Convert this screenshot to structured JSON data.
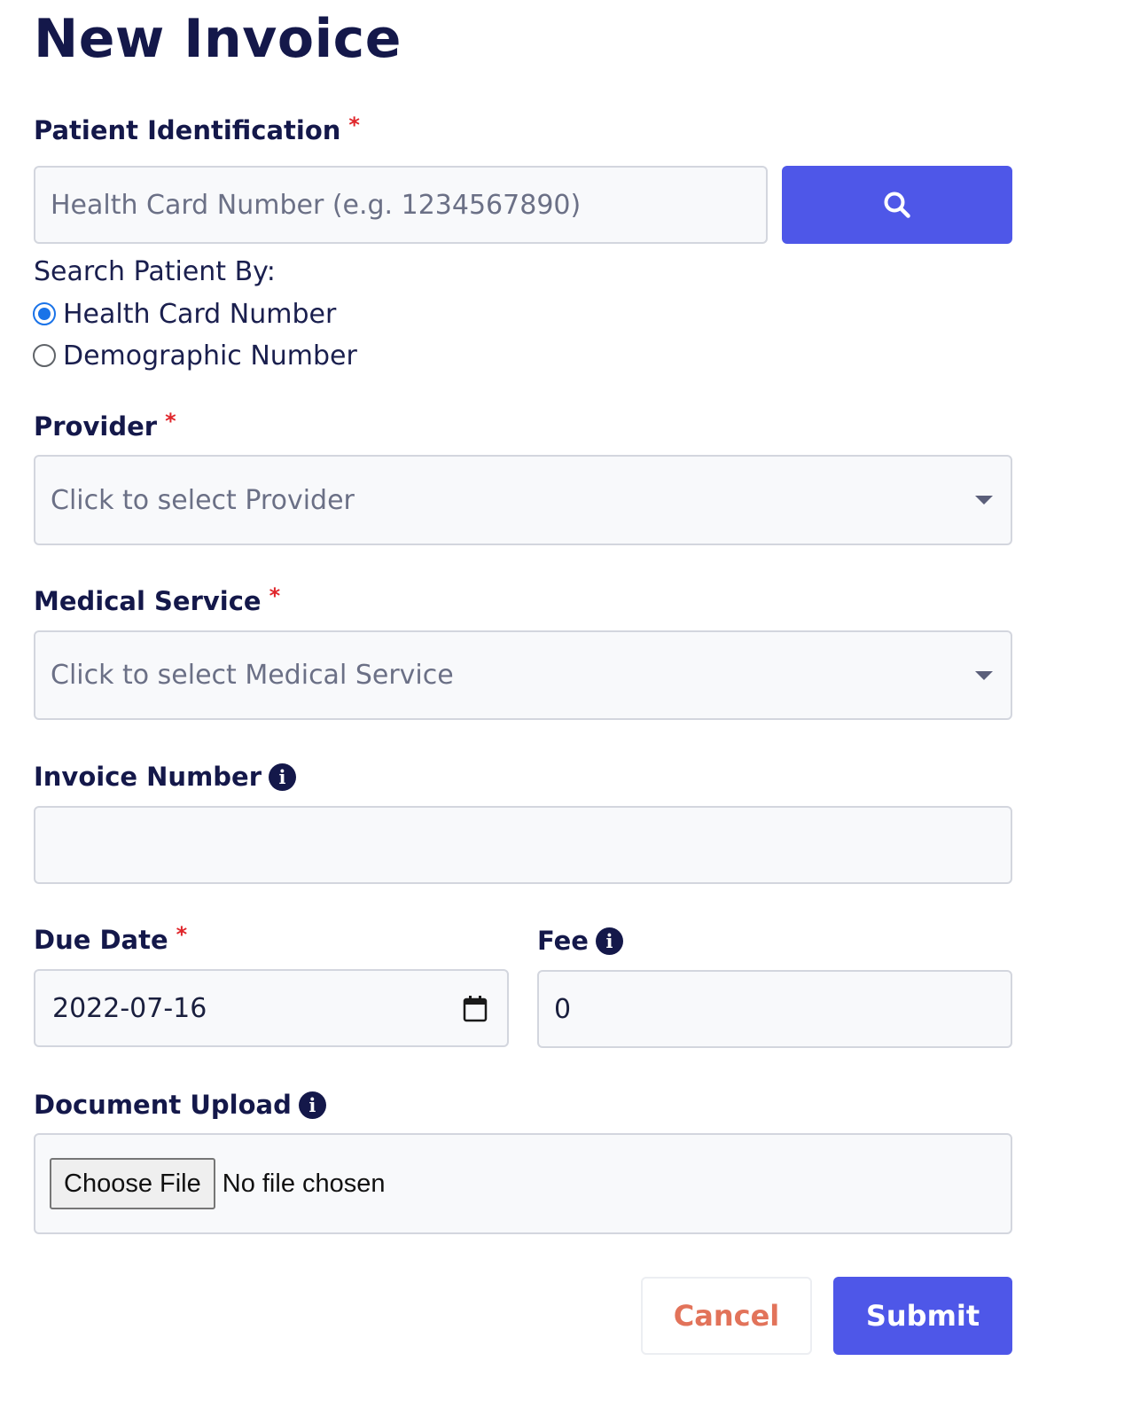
{
  "page": {
    "title": "New Invoice"
  },
  "patient": {
    "label": "Patient Identification",
    "required_mark": "*",
    "placeholder": "Health Card Number (e.g. 1234567890)",
    "value": "",
    "search_icon": "search-icon"
  },
  "search_by": {
    "label": "Search Patient By:",
    "options": [
      {
        "label": "Health Card Number",
        "checked": true
      },
      {
        "label": "Demographic Number",
        "checked": false
      }
    ]
  },
  "provider": {
    "label": "Provider",
    "required_mark": "*",
    "placeholder": "Click to select Provider"
  },
  "medical_service": {
    "label": "Medical Service",
    "required_mark": "*",
    "placeholder": "Click to select Medical Service"
  },
  "invoice_number": {
    "label": "Invoice Number",
    "info_icon": "info-icon",
    "value": ""
  },
  "due_date": {
    "label": "Due Date",
    "required_mark": "*",
    "value": "2022-07-16"
  },
  "fee": {
    "label": "Fee",
    "info_icon": "info-icon",
    "value": "0"
  },
  "document_upload": {
    "label": "Document Upload",
    "info_icon": "info-icon",
    "button_label": "Choose File",
    "status": "No file chosen"
  },
  "actions": {
    "cancel_label": "Cancel",
    "submit_label": "Submit"
  },
  "colors": {
    "primary": "#4e57e8",
    "heading": "#14184a",
    "required": "#e0262b",
    "cancel_text": "#e2735a",
    "radio_checked": "#1a73e8"
  }
}
